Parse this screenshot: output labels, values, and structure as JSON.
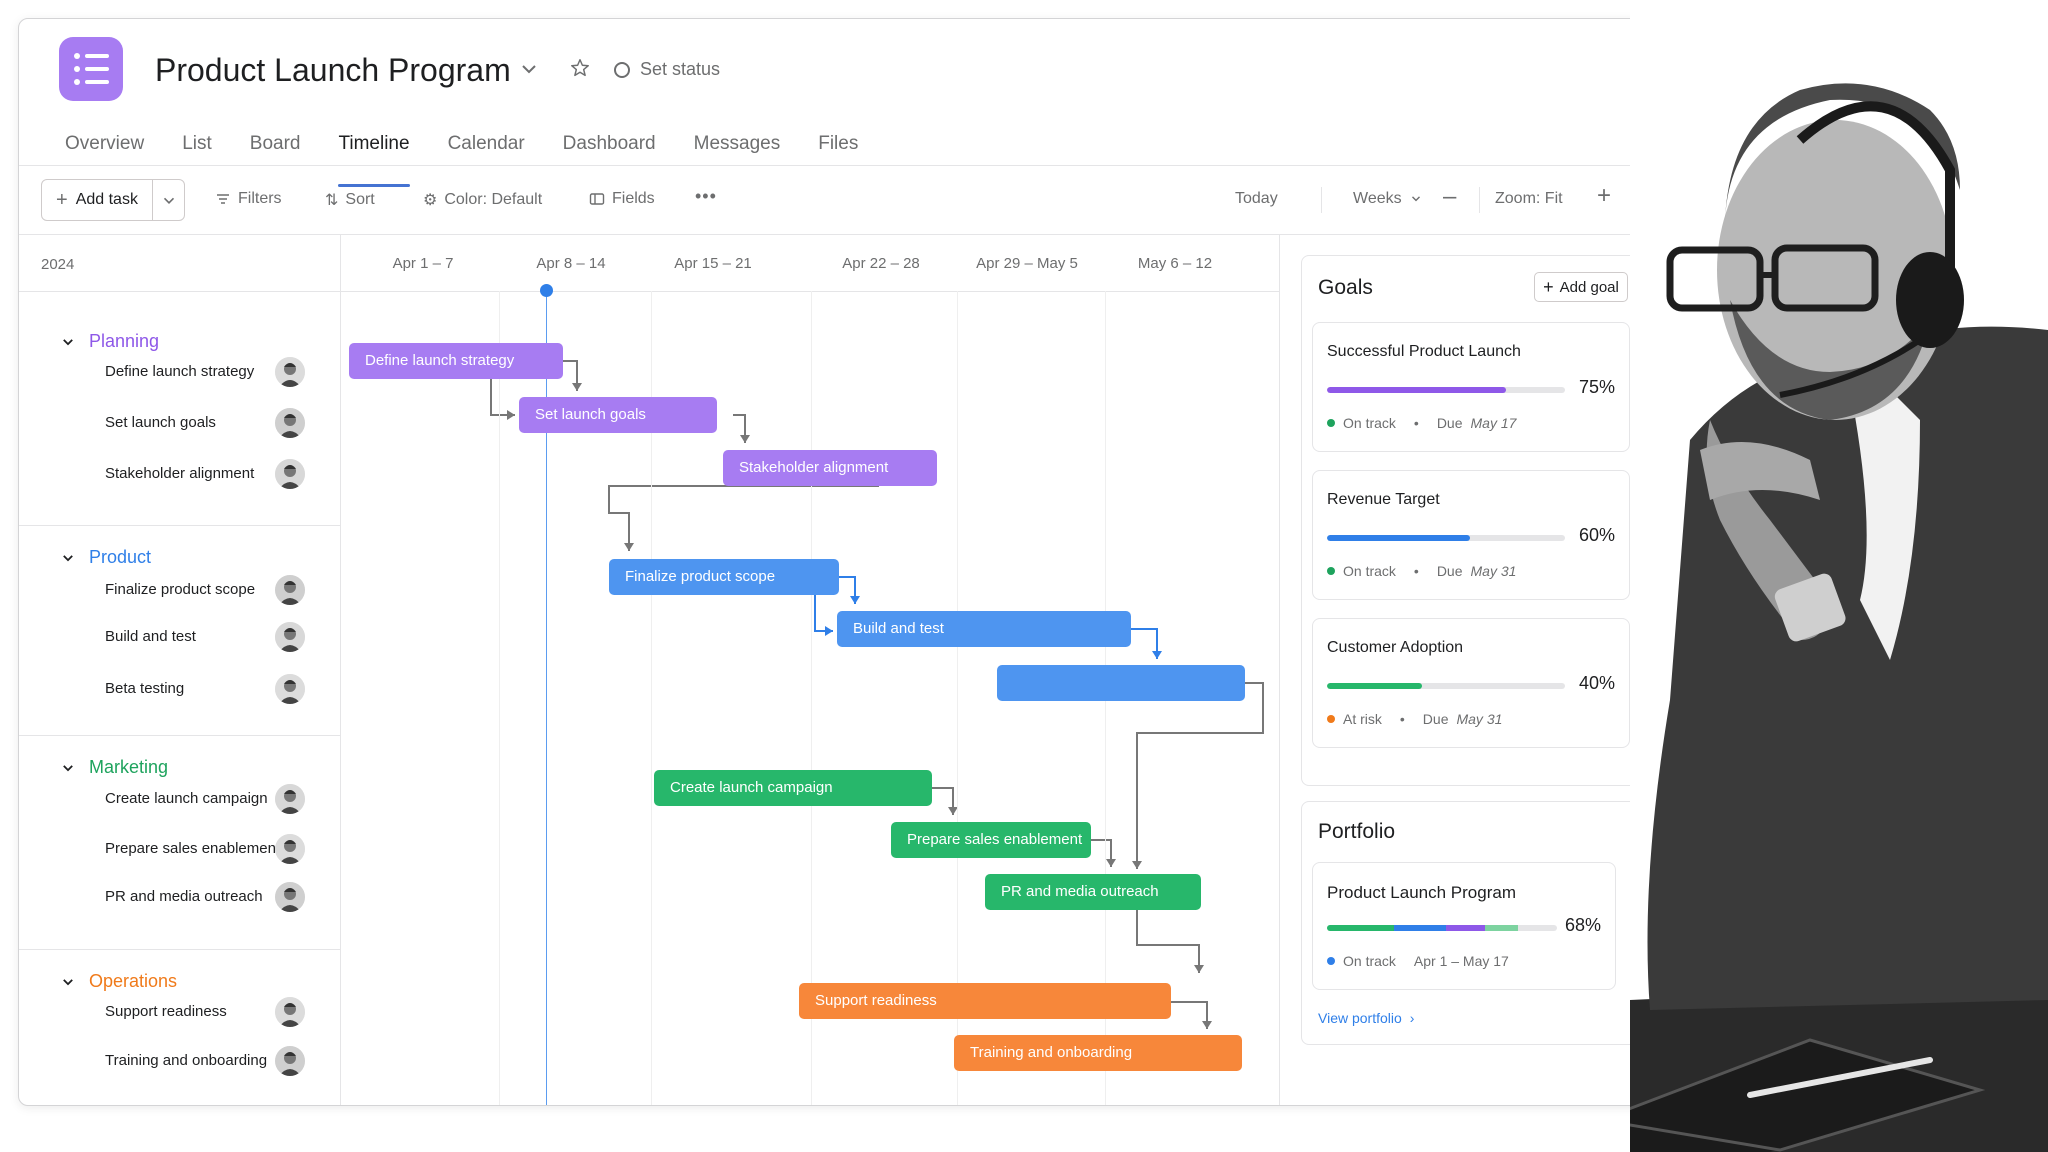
{
  "project": {
    "title": "Product Launch Program",
    "set_status": "Set status",
    "color": "#a77cf2"
  },
  "tabs": [
    "Overview",
    "List",
    "Board",
    "Timeline",
    "Calendar",
    "Dashboard",
    "Messages",
    "Files"
  ],
  "active_tab": "Timeline",
  "toolbar": {
    "add_task": "Add task",
    "filters": "Filters",
    "sort": "Sort",
    "color": "Color: Default",
    "fields": "Fields",
    "more": "•••",
    "today": "Today",
    "weeks": "Weeks",
    "zoom": "Zoom: Fit"
  },
  "year": "2024",
  "weeks": [
    "Apr 1 – 7",
    "Apr 8 – 14",
    "Apr 15 – 21",
    "Apr 22 – 28",
    "Apr 29 – May 5",
    "May 6 – 12"
  ],
  "sections": [
    {
      "name": "Planning",
      "color": "#8e58e8",
      "tasks": [
        "Define launch strategy",
        "Set launch goals",
        "Stakeholder alignment"
      ]
    },
    {
      "name": "Product",
      "color": "#2f7fe8",
      "tasks": [
        "Finalize product scope",
        "Build and test",
        "Beta testing"
      ]
    },
    {
      "name": "Marketing",
      "color": "#1ea35d",
      "tasks": [
        "Create launch campaign",
        "Prepare sales enablement",
        "PR and media outreach"
      ]
    },
    {
      "name": "Operations",
      "color": "#f07a1a",
      "tasks": [
        "Support readiness",
        "Training and onboarding"
      ]
    }
  ],
  "bars": [
    {
      "label": "Define launch strategy",
      "color": "#a77cf2"
    },
    {
      "label": "Set launch goals",
      "color": "#a77cf2"
    },
    {
      "label": "Stakeholder alignment",
      "color": "#a77cf2"
    },
    {
      "label": "Finalize product scope",
      "color": "#4e95f0"
    },
    {
      "label": "Build and test",
      "color": "#4e95f0"
    },
    {
      "label": "",
      "color": "#4e95f0"
    },
    {
      "label": "Create launch campaign",
      "color": "#27b76b"
    },
    {
      "label": "Prepare sales enablement",
      "color": "#27b76b"
    },
    {
      "label": "PR and media outreach",
      "color": "#27b76b"
    },
    {
      "label": "Support readiness",
      "color": "#f7873a"
    },
    {
      "label": "Training and onboarding",
      "color": "#f7873a"
    }
  ],
  "goals": {
    "title": "Goals",
    "add_goal": "Add goal",
    "items": [
      {
        "name": "Successful Product Launch",
        "percent": "75%",
        "progress": 0.75,
        "status": "On track",
        "status_color": "#1ea35d",
        "due_label": "Due",
        "due": "May 17",
        "bar_color": "#8e58e8"
      },
      {
        "name": "Revenue Target",
        "percent": "60%",
        "progress": 0.6,
        "status": "On track",
        "status_color": "#1ea35d",
        "due_label": "Due",
        "due": "May 31",
        "bar_color": "#2f7fe8"
      },
      {
        "name": "Customer Adoption",
        "percent": "40%",
        "progress": 0.4,
        "status": "At risk",
        "status_color": "#f07a1a",
        "due_label": "Due",
        "due": "May 31",
        "bar_color": "#27b76b"
      }
    ]
  },
  "portfolio": {
    "title": "Portfolio",
    "project": "Product Launch Program",
    "percent": "68%",
    "progress": 0.68,
    "status": "On track",
    "dates": "Apr 1 – May 17",
    "link": "View portfolio"
  }
}
